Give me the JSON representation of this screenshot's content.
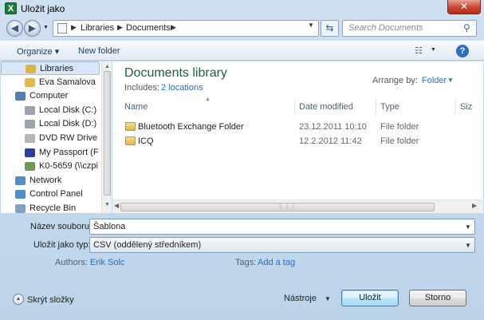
{
  "window": {
    "title": "Uložit jako",
    "app_icon_letter": "X",
    "close_glyph": "✕"
  },
  "address": {
    "crumbs": [
      "Libraries",
      "Documents"
    ],
    "separator": "▶"
  },
  "search": {
    "placeholder": "Search Documents"
  },
  "toolbar": {
    "organize": "Organize ▾",
    "new_folder": "New folder",
    "help": "?"
  },
  "sidebar": {
    "items": [
      {
        "label": "Libraries",
        "icon": "libraries-icon",
        "color": "#d9b44a"
      },
      {
        "label": "Eva Samalova",
        "icon": "user-folder-icon",
        "color": "#e1b94f"
      },
      {
        "label": "Computer",
        "icon": "computer-icon",
        "color": "#4f7fb5"
      },
      {
        "label": "Local Disk (C:)",
        "icon": "drive-icon",
        "color": "#9aa3ad"
      },
      {
        "label": "Local Disk (D:)",
        "icon": "drive-icon",
        "color": "#9aa3ad"
      },
      {
        "label": "DVD RW Drive (",
        "icon": "dvd-icon",
        "color": "#b5b5b5"
      },
      {
        "label": "My Passport (F",
        "icon": "usb-drive-icon",
        "color": "#2c3f9c"
      },
      {
        "label": "K0-5659 (\\\\czpi",
        "icon": "network-drive-icon",
        "color": "#6d9a52"
      },
      {
        "label": "Network",
        "icon": "network-icon",
        "color": "#4f8fc9"
      },
      {
        "label": "Control Panel",
        "icon": "control-panel-icon",
        "color": "#4f8fc9"
      },
      {
        "label": "Recycle Bin",
        "icon": "recycle-bin-icon",
        "color": "#7fa3c4"
      }
    ]
  },
  "library": {
    "title": "Documents library",
    "includes_label": "Includes:",
    "includes_link": "2 locations",
    "arrange_label": "Arrange by:",
    "arrange_value": "Folder"
  },
  "columns": [
    "Name",
    "Date modified",
    "Type",
    "Size"
  ],
  "files": [
    {
      "name": "Bluetooth Exchange Folder",
      "date": "23.12.2011 10:10",
      "type": "File folder"
    },
    {
      "name": "ICQ",
      "date": "12.2.2012 11:42",
      "type": "File folder"
    }
  ],
  "form": {
    "filename_label": "Název souboru:",
    "filename_value": "Šablona",
    "filetype_label": "Uložit jako typ:",
    "filetype_value": "CSV (oddělený středníkem)",
    "authors_label": "Authors:",
    "authors_value": "Erik Solc",
    "tags_label": "Tags:",
    "tags_value": "Add a tag"
  },
  "bottom": {
    "hide_folders": "Skrýt složky",
    "tools": "Nástroje",
    "save": "Uložit",
    "cancel": "Storno"
  },
  "colors": {
    "accent_link": "#2a6dc4",
    "library_title": "#1e5f3a",
    "close_button": "#c7452f"
  }
}
